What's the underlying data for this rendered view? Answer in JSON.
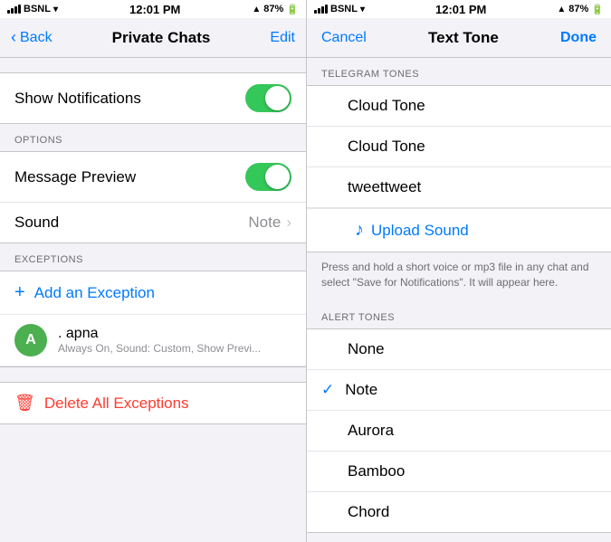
{
  "left": {
    "statusBar": {
      "carrier": "BSNL",
      "time": "12:01 PM",
      "battery": "87%"
    },
    "navBar": {
      "backLabel": "Back",
      "title": "Private Chats",
      "editLabel": "Edit"
    },
    "showNotifications": {
      "label": "Show Notifications"
    },
    "optionsSection": {
      "label": "OPTIONS",
      "rows": [
        {
          "label": "Message Preview",
          "type": "toggle"
        },
        {
          "label": "Sound",
          "value": "Note",
          "type": "detail"
        }
      ]
    },
    "exceptionsSection": {
      "label": "EXCEPTIONS",
      "addException": "Add an Exception",
      "exception": {
        "initial": "A",
        "name": ". apna",
        "detail": "Always On, Sound: Custom, Show Previ..."
      },
      "deleteAll": "Delete All Exceptions"
    }
  },
  "right": {
    "statusBar": {
      "carrier": "BSNL",
      "time": "12:01 PM",
      "battery": "87%"
    },
    "navBar": {
      "cancelLabel": "Cancel",
      "title": "Text Tone",
      "doneLabel": "Done"
    },
    "telegramSection": {
      "label": "TELEGRAM TONES",
      "tones": [
        {
          "label": "Cloud Tone",
          "selected": false
        },
        {
          "label": "Cloud Tone",
          "selected": false
        },
        {
          "label": "tweettweet",
          "selected": false
        }
      ],
      "upload": "Upload Sound"
    },
    "infoText": "Press and hold a short voice or mp3 file in any chat and select \"Save for Notifications\". It will appear here.",
    "alertSection": {
      "label": "ALERT TONES",
      "tones": [
        {
          "label": "None",
          "selected": false
        },
        {
          "label": "Note",
          "selected": true
        },
        {
          "label": "Aurora",
          "selected": false
        },
        {
          "label": "Bamboo",
          "selected": false
        },
        {
          "label": "Chord",
          "selected": false
        }
      ]
    }
  }
}
